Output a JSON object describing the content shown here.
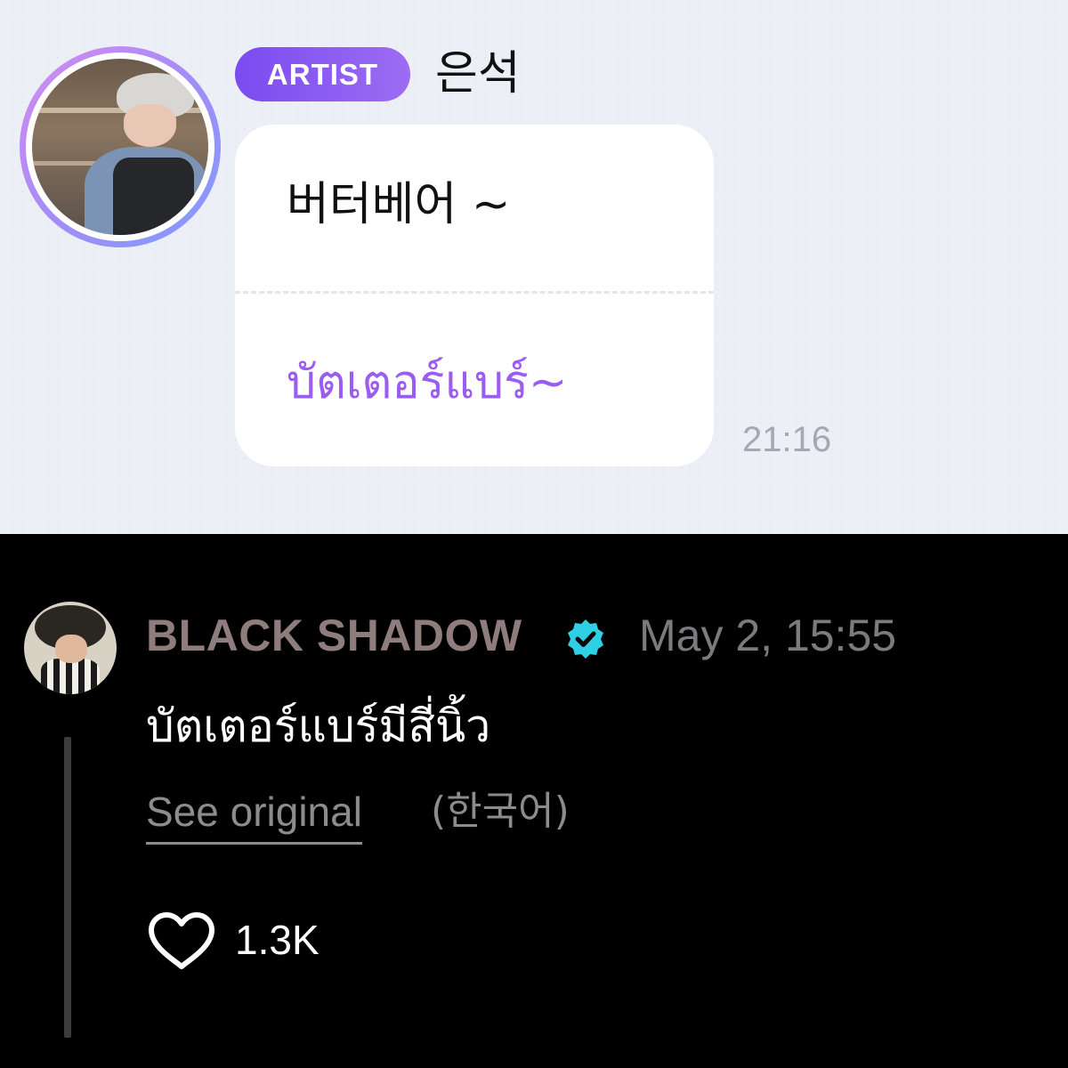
{
  "message": {
    "badge": "ARTIST",
    "sender_name": "은석",
    "original_text": "버터베어 ~",
    "translated_text": "บัตเตอร์แบร์~",
    "time": "21:16"
  },
  "comment": {
    "author": "BLACK SHADOW",
    "verified": true,
    "timestamp": "May 2, 15:55",
    "text": "บัตเตอร์แบร์มีสี่นิ้ว",
    "see_original_label": "See original",
    "original_language": "(한국어)",
    "like_count": "1.3K"
  },
  "icons": {
    "verified": "verified-badge-icon",
    "like": "heart-outline-icon"
  },
  "colors": {
    "badge_gradient_start": "#7a4cf0",
    "badge_gradient_end": "#9d6cf3",
    "translation_text": "#9a5cf2",
    "verified_badge": "#2fd0e6",
    "author_name": "#8f7d7d",
    "chat_background": "#eceff6"
  }
}
